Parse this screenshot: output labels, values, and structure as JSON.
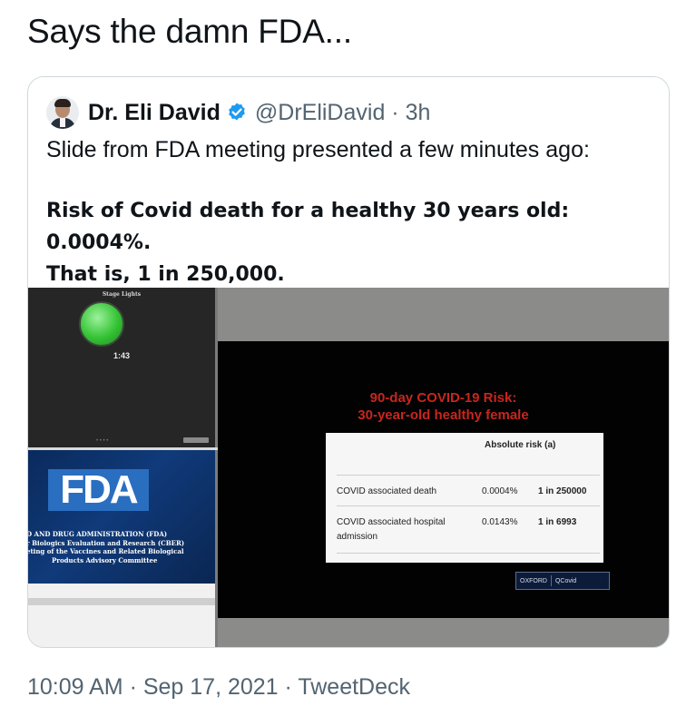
{
  "tweet": {
    "text": "Says the damn FDA..."
  },
  "quoted_tweet": {
    "author_name": "Dr. Eli David",
    "handle_time": "@DrEliDavid · 3h",
    "line1": "Slide from FDA meeting presented a few minutes ago:",
    "line2": "Risk of Covid death for a healthy 30 years old: 0.0004%.",
    "line3": "That is, 1 in 250,000.",
    "verified_color": "#1d9bf0"
  },
  "media": {
    "stage_lights_label": "Stage Lights",
    "timer": "1:43",
    "fda_logo": "FDA",
    "fda_lines": [
      "D AND DRUG ADMINISTRATION (FDA)",
      "r Biologics Evaluation and Research (CBER)",
      "eting of the Vaccines and Related Biological",
      "Products Advisory Committee"
    ],
    "slide_title_1": "90-day COVID-19 Risk:",
    "slide_title_2": "30-year-old healthy female",
    "table_header": "Absolute risk (a)",
    "rows": [
      {
        "label": "COVID associated death",
        "percent": "0.0004%",
        "ratio": "1 in 250000"
      },
      {
        "label": "COVID associated hospital admission",
        "percent": "0.0143%",
        "ratio": "1 in 6993"
      }
    ],
    "oxford_label": "OXFORD",
    "qcovid_label": "QCovid"
  },
  "footer": {
    "timestamp": "10:09 AM · Sep 17, 2021 · TweetDeck"
  }
}
